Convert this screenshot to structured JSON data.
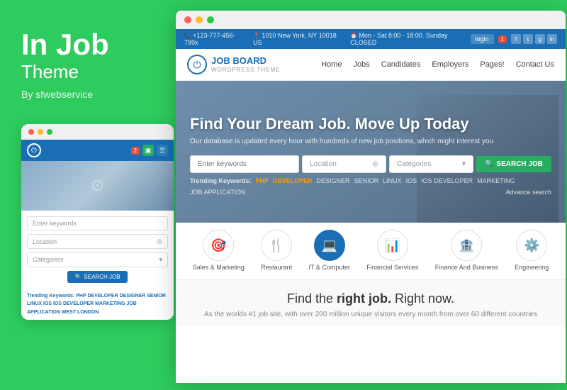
{
  "brand": {
    "title": "In Job",
    "subtitle": "Theme",
    "author": "By sfwebservice"
  },
  "topbar": {
    "phone": "+123-777-456-799x",
    "address": "1010 New York, NY 10018 US",
    "hours": "Mon - Sat 8:00 - 18:00. Sunday CLOSED",
    "login_label": "login",
    "notif_count": "1"
  },
  "header": {
    "logo_name": "JOB BOARD",
    "logo_sub": "WORDPRESS THEME",
    "nav_items": [
      "Home",
      "Jobs",
      "Candidates",
      "Employers",
      "Pages!",
      "Contact Us"
    ]
  },
  "hero": {
    "title": "Find Your Dream Job. Move Up Today",
    "subtitle": "Our database is updated every hour with hundreds of new job positions, which might interest you",
    "search_placeholder": "Enter keywords",
    "location_placeholder": "Location",
    "categories_placeholder": "Categories",
    "search_btn": "SEARCH JOB",
    "advance_search": "Advance search",
    "trending_label": "Trending Keywords:",
    "trending_tags": [
      "PHP",
      "DEVELOPER",
      "DESIGNER",
      "SENIOR",
      "LINUX",
      "IOS",
      "IOS DEVELOPER",
      "MARKETING",
      "JOB APPLICATION",
      "WEST LONDON"
    ]
  },
  "categories": [
    {
      "name": "Sales & Marketing",
      "icon": "🎯"
    },
    {
      "name": "Restaurant",
      "icon": "🍴"
    },
    {
      "name": "IT & Computer",
      "icon": "💻",
      "active": true
    },
    {
      "name": "Financial Services",
      "icon": "📊"
    },
    {
      "name": "Finance And Business",
      "icon": "🏦"
    },
    {
      "name": "Engineering",
      "icon": "⚙️"
    }
  ],
  "bottom": {
    "title_plain": "Find the ",
    "title_bold": "right job.",
    "title_end": " Right now.",
    "desc": "As the worlds #1 job site, with over 200 million unique visitors every month from over 60 different countries"
  },
  "mini": {
    "search_placeholder": "Enter keywords",
    "location_placeholder": "Location",
    "categories_placeholder": "Categories",
    "search_btn": "SEARCH JOB",
    "trending_text": "Trending Keywords: PHP DEVELOPER DESIGNER SENIOR LINUX IOS IOS DEVELOPER MARKETING JOB APPLICATION WEST LONDON"
  }
}
